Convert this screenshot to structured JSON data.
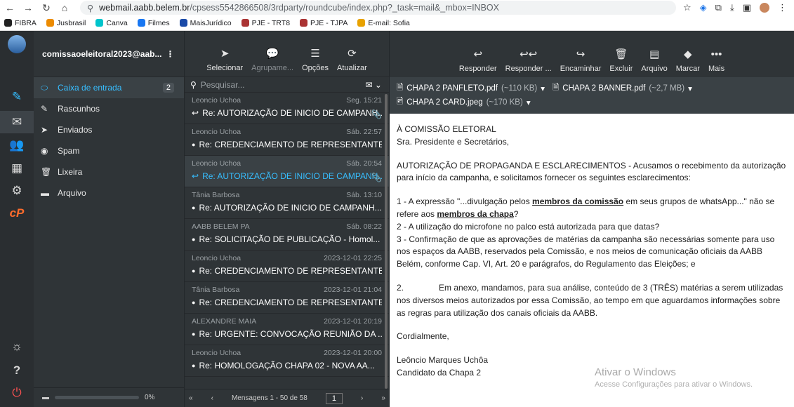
{
  "browser": {
    "url_host": "webmail.aabb.belem.br",
    "url_path": "/cpsess5542866508/3rdparty/roundcube/index.php?_task=mail&_mbox=INBOX",
    "bookmarks": [
      {
        "label": "FIBRA",
        "color": "#222"
      },
      {
        "label": "Jusbrasil",
        "color": "#ec8b00"
      },
      {
        "label": "Canva",
        "color": "#00c4cc"
      },
      {
        "label": "Filmes",
        "color": "#1877f2"
      },
      {
        "label": "MaisJurídico",
        "color": "#1a4aa8"
      },
      {
        "label": "PJE - TRT8",
        "color": "#a33"
      },
      {
        "label": "PJE - TJPA",
        "color": "#a33"
      },
      {
        "label": "E-mail: Sofia",
        "color": "#e8a200"
      }
    ]
  },
  "account": "comissaoeleitoral2023@aab...",
  "folders": [
    {
      "label": "Caixa de entrada",
      "count": "2",
      "icon": "inbox-icon"
    },
    {
      "label": "Rascunhos",
      "icon": "pencil-icon"
    },
    {
      "label": "Enviados",
      "icon": "send-icon"
    },
    {
      "label": "Spam",
      "icon": "spam-icon"
    },
    {
      "label": "Lixeira",
      "icon": "trash-icon"
    },
    {
      "label": "Arquivo",
      "icon": "archive-icon"
    }
  ],
  "quota": "0%",
  "list_toolbar": {
    "select": "Selecionar",
    "group": "Agrupame...",
    "options": "Opções",
    "refresh": "Atualizar"
  },
  "search_placeholder": "Pesquisar...",
  "messages": [
    {
      "from": "Leoncio Uchoa",
      "date": "Seg. 15:21",
      "subject": "Re: AUTORIZAÇÃO DE INICIO DE CAMPANH...",
      "replied": true,
      "attach": true
    },
    {
      "from": "Leoncio Uchoa",
      "date": "Sáb. 22:57",
      "subject": "Re: CREDENCIAMENTO DE REPRESENTANTE"
    },
    {
      "from": "Leoncio Uchoa",
      "date": "Sáb. 20:54",
      "subject": "Re: AUTORIZAÇÃO DE INICIO DE CAMPANH...",
      "replied": true,
      "attach": true
    },
    {
      "from": "Tânia Barbosa",
      "date": "Sáb. 13:10",
      "subject": "Re: AUTORIZAÇÃO DE INICIO DE CAMPANH..."
    },
    {
      "from": "AABB BELEM PA",
      "date": "Sáb. 08:22",
      "subject": "Re: SOLICITAÇÃO DE PUBLICAÇÃO - Homol..."
    },
    {
      "from": "Leoncio Uchoa",
      "date": "2023-12-01 22:25",
      "subject": "Re: CREDENCIAMENTO DE REPRESENTANTE"
    },
    {
      "from": "Tânia Barbosa",
      "date": "2023-12-01 21:04",
      "subject": "Re: CREDENCIAMENTO DE REPRESENTANTE"
    },
    {
      "from": "ALEXANDRE MAIA",
      "date": "2023-12-01 20:19",
      "subject": "Re: URGENTE: CONVOCAÇÃO REUNIÃO DA ..."
    },
    {
      "from": "Leoncio Uchoa",
      "date": "2023-12-01 20:00",
      "subject": "Re: HOMOLOGAÇÃO CHAPA 02 - NOVA AA..."
    }
  ],
  "pager": {
    "text": "Mensagens 1 - 50 de 58",
    "page": "1"
  },
  "read_toolbar": {
    "reply": "Responder",
    "reply_all": "Responder ...",
    "forward": "Encaminhar",
    "delete": "Excluir",
    "archive": "Arquivo",
    "mark": "Marcar",
    "more": "Mais"
  },
  "attachments": [
    {
      "name": "CHAPA 2 PANFLETO.pdf",
      "size": "(~110 KB)"
    },
    {
      "name": "CHAPA 2 BANNER.pdf",
      "size": "(~2,7 MB)"
    },
    {
      "name": "CHAPA 2 CARD.jpeg",
      "size": "(~170 KB)"
    }
  ],
  "body": {
    "l1": "À COMISSÃO ELETORAL",
    "l2": "Sra. Presidente e Secretários,",
    "p1": "AUTORIZAÇÃO DE PROPAGANDA E ESCLARECIMENTOS - Acusamos o recebimento da autorização para início da campanha, e solicitamos fornecer os seguintes esclarecimentos:",
    "i1a": "1 -  A expressão \"...divulgação pelos ",
    "i1b": "membros da comissão",
    "i1c": " em seus grupos de whatsApp...\" não se refere aos ",
    "i1d": "membros da chapa",
    "i1e": "?",
    "i2": "2 - A utilização do microfone no palco está autorizada para que datas?",
    "i3": "3 - Confirmação de que as aprovações de matérias da campanha são necessárias somente para uso nos espaços da AABB, reservados pela Comissão, e nos meios de  comunicação oficiais da AABB Belém, conforme Cap. VI, Art. 20 e parágrafos, do Regulamento das Eleições; e",
    "i4": "2.               Em anexo, mandamos, para sua análise, conteúdo de 3 (TRÊS) matérias a serem utilizadas nos diversos meios autorizados por essa Comissão, ao tempo em que aguardamos informações sobre as regras para utilização dos canais oficiais da AABB.",
    "close": "Cordialmente,",
    "sig1": "Leôncio Marques Uchôa",
    "sig2": "Candidato da Chapa 2"
  },
  "watermark": {
    "title": "Ativar o Windows",
    "sub": "Acesse Configurações para ativar o Windows."
  }
}
